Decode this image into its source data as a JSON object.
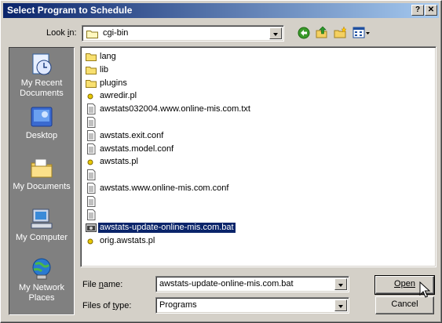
{
  "window": {
    "title": "Select Program to Schedule",
    "help_label": "?",
    "close_label": "✕"
  },
  "look_in": {
    "label": "Look in:",
    "value": "cgi-bin"
  },
  "toolbar": {
    "icons": [
      "back-icon",
      "up-folder-icon",
      "new-folder-icon",
      "view-menu-icon"
    ]
  },
  "places": [
    {
      "label": "My Recent Documents",
      "icon": "recent-documents-icon"
    },
    {
      "label": "Desktop",
      "icon": "desktop-icon"
    },
    {
      "label": "My Documents",
      "icon": "my-documents-icon"
    },
    {
      "label": "My Computer",
      "icon": "my-computer-icon"
    },
    {
      "label": "My Network Places",
      "icon": "network-places-icon"
    }
  ],
  "files": [
    {
      "name": "lang",
      "type": "folder"
    },
    {
      "name": "lib",
      "type": "folder"
    },
    {
      "name": "plugins",
      "type": "folder"
    },
    {
      "name": "awredir.pl",
      "type": "script"
    },
    {
      "name": "awstats032004.www.online-mis.com.txt",
      "type": "text"
    },
    {
      "name": "",
      "type": "text"
    },
    {
      "name": "awstats.exit.conf",
      "type": "text"
    },
    {
      "name": "awstats.model.conf",
      "type": "text"
    },
    {
      "name": "awstats.pl",
      "type": "script"
    },
    {
      "name": "",
      "type": "text"
    },
    {
      "name": "awstats.www.online-mis.com.conf",
      "type": "text"
    },
    {
      "name": "",
      "type": "text"
    },
    {
      "name": "",
      "type": "text"
    },
    {
      "name": "awstats-update-online-mis.com.bat",
      "type": "batch",
      "selected": true
    },
    {
      "name": "orig.awstats.pl",
      "type": "script"
    }
  ],
  "file_name": {
    "label": "File name:",
    "value": "awstats-update-online-mis.com.bat"
  },
  "files_of_type": {
    "label": "Files of type:",
    "value": "Programs"
  },
  "buttons": {
    "open": "Open",
    "cancel": "Cancel"
  }
}
